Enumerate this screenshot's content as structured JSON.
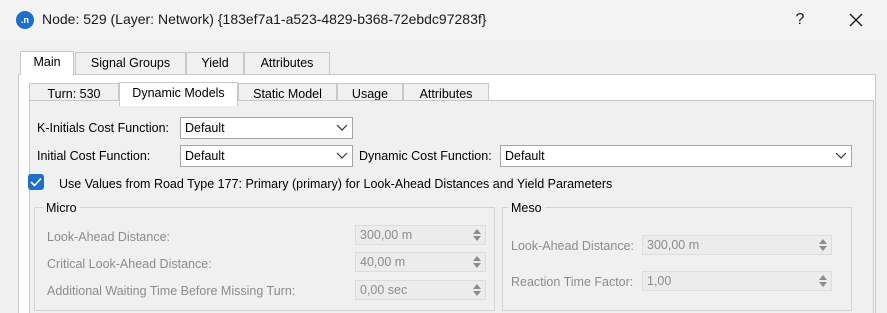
{
  "window": {
    "icon_text": ".n",
    "title": "Node: 529 (Layer: Network) {183ef7a1-a523-4829-b368-72ebdc97283f}",
    "help_label": "?"
  },
  "main_tabs": [
    "Main",
    "Signal Groups",
    "Yield",
    "Attributes"
  ],
  "sub_tabs": [
    "Turn: 530",
    "Dynamic Models",
    "Static Model",
    "Usage",
    "Attributes"
  ],
  "form": {
    "k_initials_label": "K-Initials Cost Function:",
    "k_initials_value": "Default",
    "initial_cost_label": "Initial Cost Function:",
    "initial_cost_value": "Default",
    "dynamic_cost_label": "Dynamic Cost Function:",
    "dynamic_cost_value": "Default",
    "use_values_label": "Use Values from Road Type 177: Primary (primary) for Look-Ahead Distances and Yield Parameters",
    "use_values_checked": true
  },
  "micro": {
    "title": "Micro",
    "look_ahead_label": "Look-Ahead Distance:",
    "look_ahead_value": "300,00 m",
    "critical_label": "Critical Look-Ahead Distance:",
    "critical_value": "40,00 m",
    "waiting_label": "Additional Waiting Time Before Missing Turn:",
    "waiting_value": "0,00 sec"
  },
  "meso": {
    "title": "Meso",
    "look_ahead_label": "Look-Ahead Distance:",
    "look_ahead_value": "300,00 m",
    "reaction_label": "Reaction Time Factor:",
    "reaction_value": "1,00"
  },
  "colors": {
    "accent": "#1e6fc7",
    "disabled_text": "#8c8c8c"
  }
}
